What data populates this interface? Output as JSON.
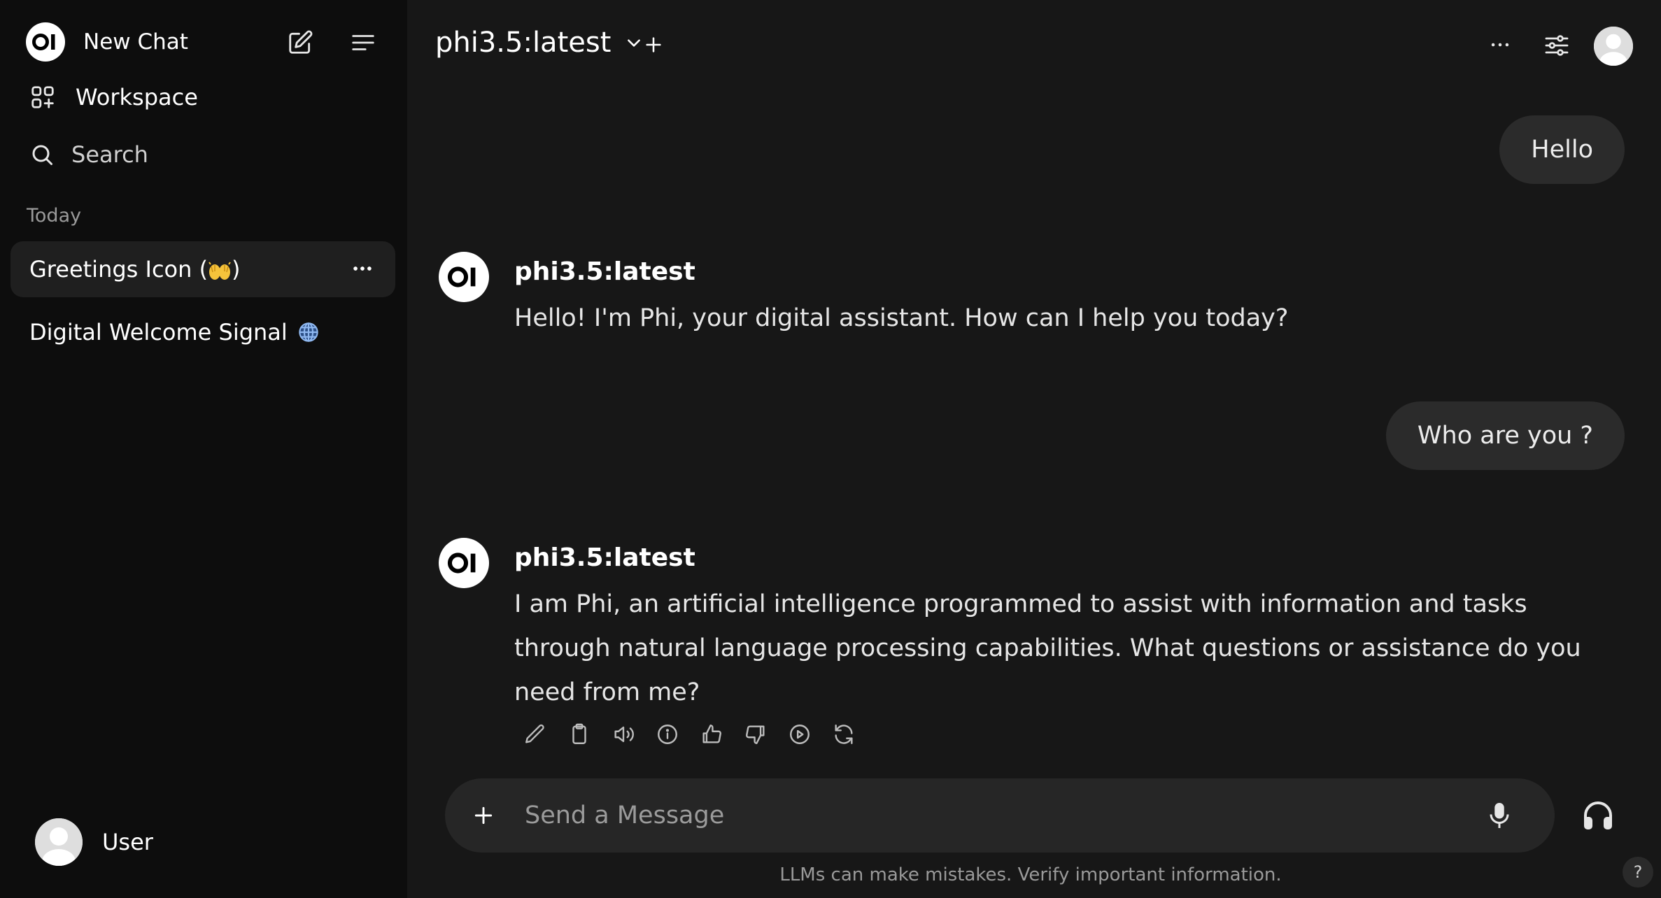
{
  "sidebar": {
    "logo_text": "OI",
    "new_chat": "New Chat",
    "workspace": "Workspace",
    "search": "Search",
    "section_today": "Today",
    "chats": [
      {
        "title": "Greetings Icon (",
        "emoji": "raising-hands",
        "suffix": ")"
      },
      {
        "title": "Digital Welcome Signal",
        "emoji": "globe"
      }
    ],
    "user_name": "User"
  },
  "header": {
    "model": "phi3.5:latest"
  },
  "messages": [
    {
      "role": "user",
      "text": "Hello"
    },
    {
      "role": "assistant",
      "model": "phi3.5:latest",
      "text": "Hello! I'm Phi, your digital assistant. How can I help you today?"
    },
    {
      "role": "user",
      "text": "Who are you ?"
    },
    {
      "role": "assistant",
      "model": "phi3.5:latest",
      "text": "I am Phi, an artificial intelligence programmed to assist with information and tasks through natural language processing capabilities. What questions or assistance do you need from me?"
    }
  ],
  "message_actions": [
    "edit-icon",
    "copy-icon",
    "read-aloud-icon",
    "info-icon",
    "thumbs-up-icon",
    "thumbs-down-icon",
    "continue-icon",
    "regenerate-icon"
  ],
  "composer": {
    "placeholder": "Send a Message"
  },
  "footer": {
    "disclaimer": "LLMs can make mistakes. Verify important information.",
    "help": "?"
  },
  "colors": {
    "sidebar_bg": "#0d0d0d",
    "main_bg": "#171717",
    "bubble_bg": "#2b2b2b",
    "composer_bg": "#262626"
  }
}
